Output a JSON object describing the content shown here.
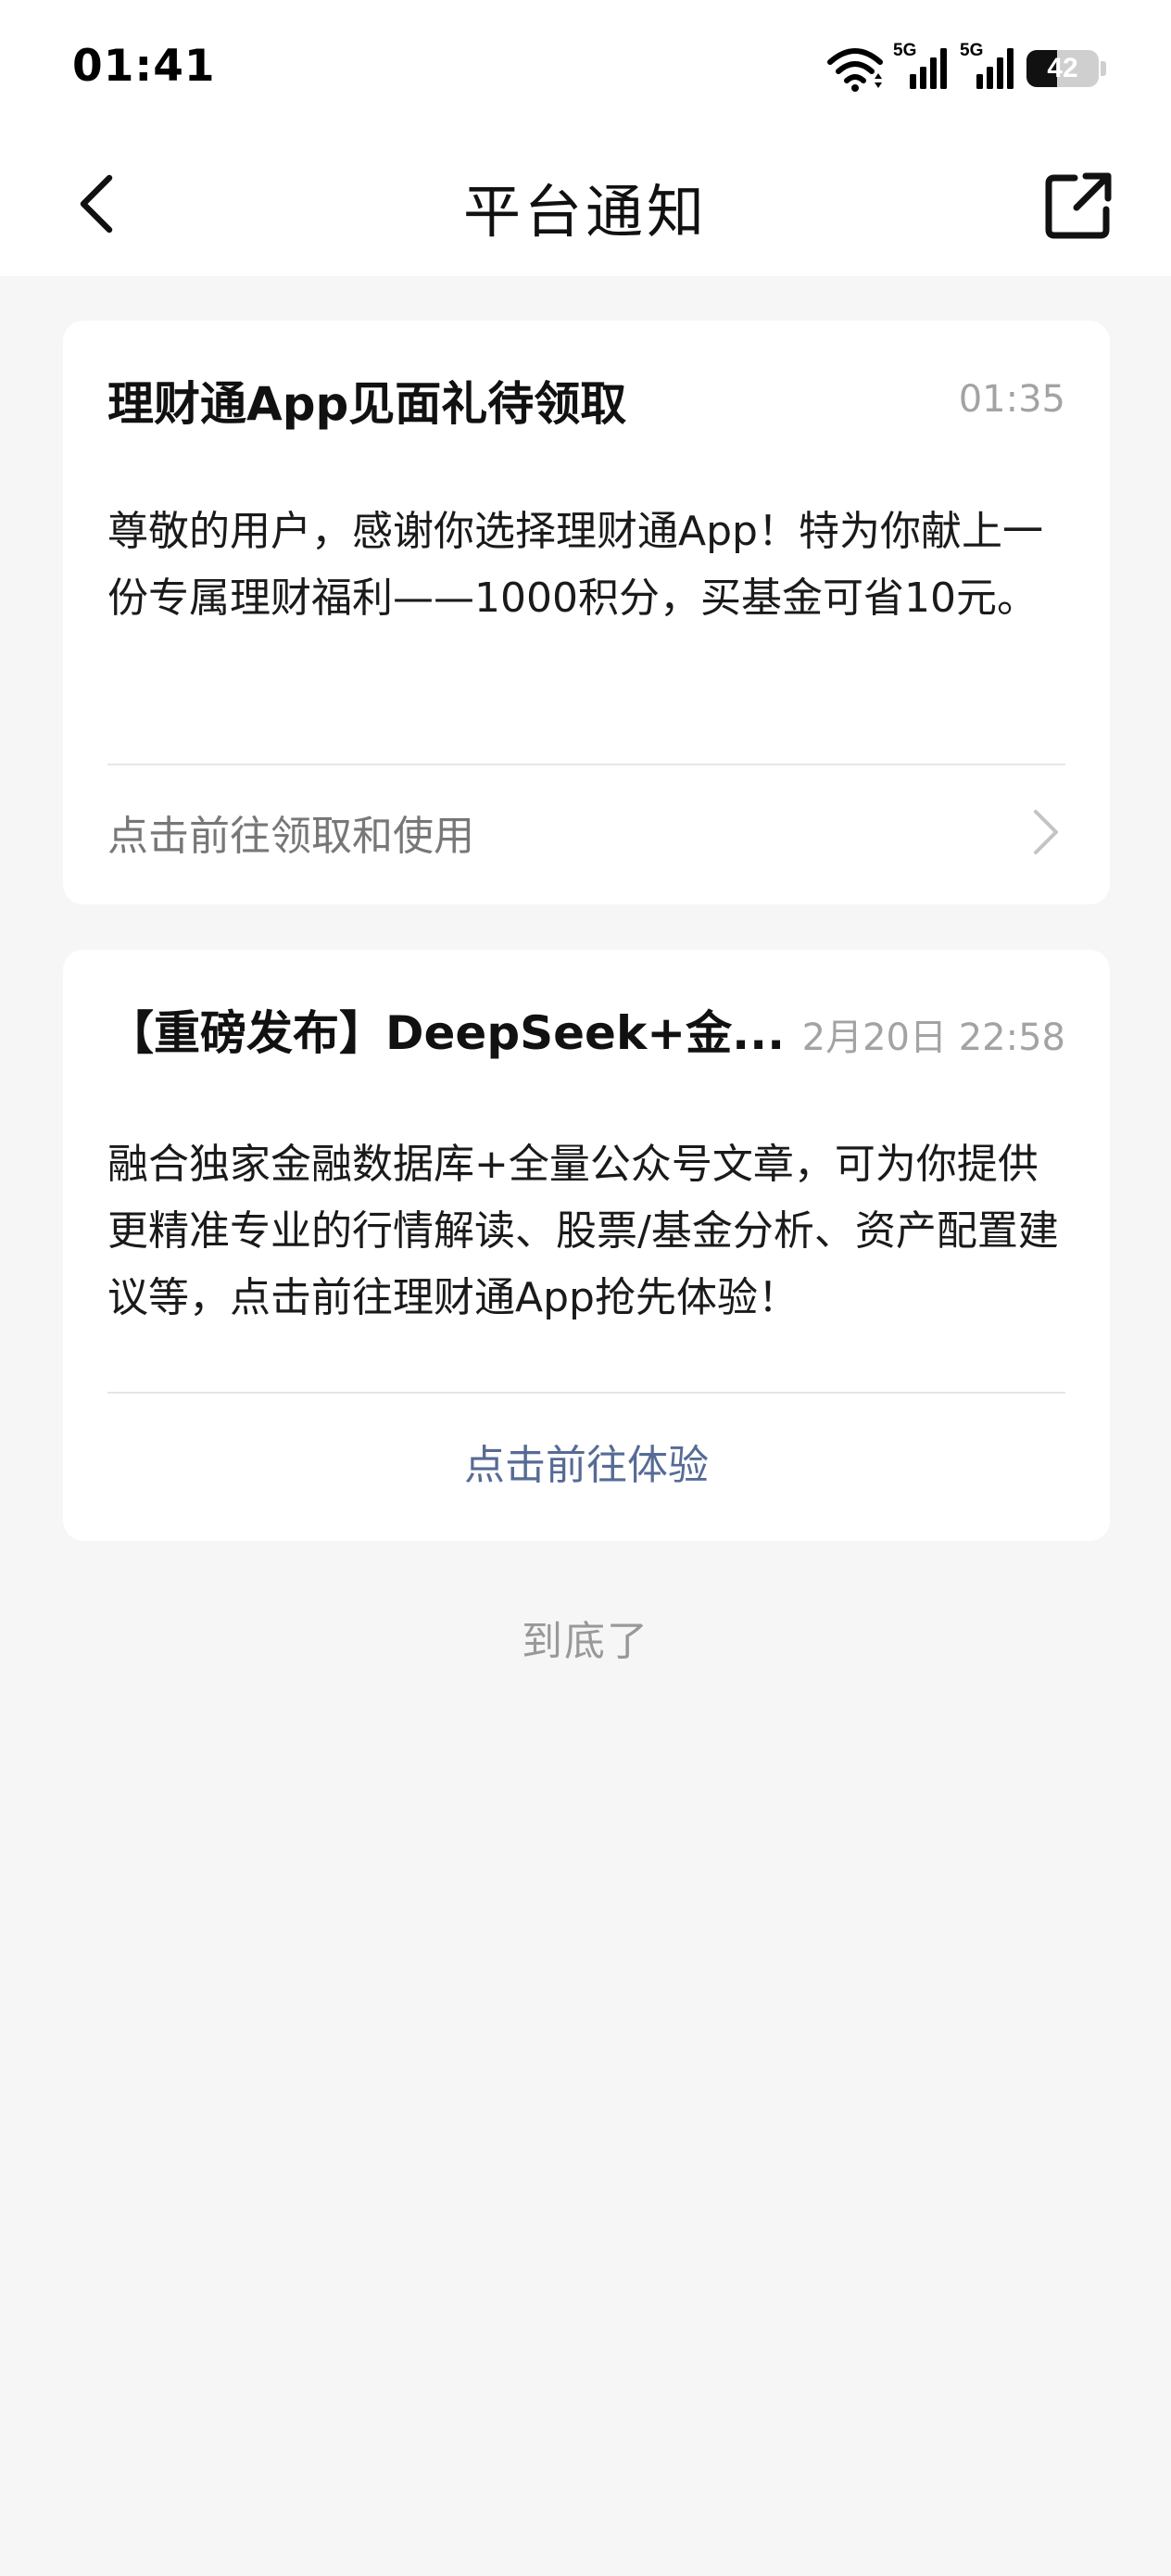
{
  "status_bar": {
    "time": "01:41",
    "signal_1_label": "5G",
    "signal_2_label": "5G",
    "battery_level": "42",
    "battery_fraction": 0.42
  },
  "nav": {
    "title": "平台通知",
    "back_icon": "chevron-left-icon",
    "share_icon": "external-link-icon"
  },
  "notifications": [
    {
      "title": "理财通App见面礼待领取",
      "time": "01:35",
      "body": "尊敬的用户，感谢你选择理财通App！特为你献上一份专属理财福利——1000积分，买基金可省10元。",
      "action": "点击前往领取和使用"
    },
    {
      "title": "【重磅发布】DeepSeek+金...",
      "time": "2月20日 22:58",
      "body": "融合独家金融数据库+全量公众号文章，可为你提供更精准专业的行情解读、股票/基金分析、资产配置建议等，点击前往理财通App抢先体验！",
      "action": "点击前往体验"
    }
  ],
  "footer": {
    "end_text": "到底了"
  },
  "colors": {
    "background": "#f6f6f6",
    "card": "#ffffff",
    "secondary_text": "#a3a3a3",
    "link": "#566b95"
  }
}
